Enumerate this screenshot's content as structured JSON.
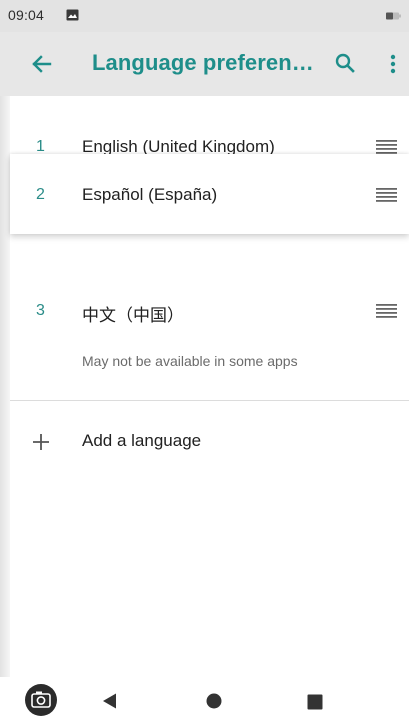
{
  "status_bar": {
    "time": "09:04",
    "icons": [
      "image-notification-icon",
      "battery-icon"
    ]
  },
  "app_bar": {
    "title": "Language preferen…",
    "icons": [
      "back-arrow-icon",
      "search-icon",
      "more-vert-icon"
    ]
  },
  "languages": [
    {
      "index": "1",
      "name": "English (United Kingdom)",
      "note": ""
    },
    {
      "index": "2",
      "name": "Español (España)",
      "note": ""
    },
    {
      "index": "3",
      "name": "中文（中国）",
      "note": "May not be available in some apps"
    }
  ],
  "add_language": {
    "label": "Add a language",
    "icon": "plus-icon"
  },
  "nav_bar": {
    "icons": [
      "camera-icon",
      "nav-back-icon",
      "nav-home-icon",
      "nav-recents-icon"
    ]
  },
  "colors": {
    "accent": "#1e8e8a",
    "index": "#2a8c88",
    "app_bar_bg": "#e7e7e7",
    "status_bar_bg": "#e3e3e3"
  }
}
